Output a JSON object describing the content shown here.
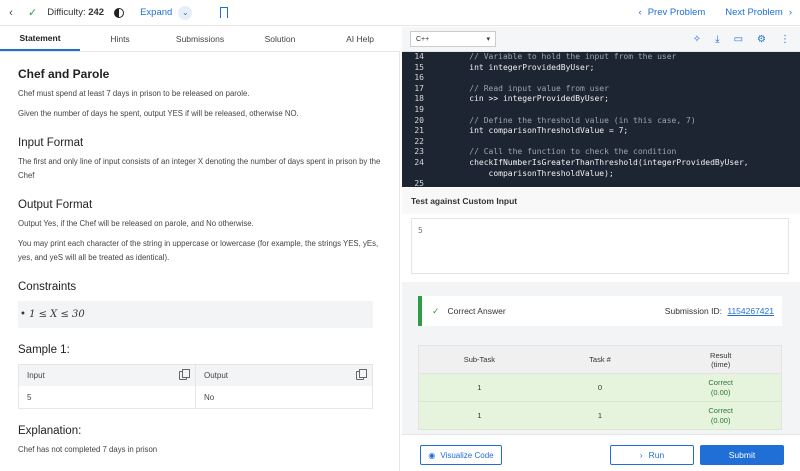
{
  "topbar": {
    "difficulty_label": "Difficulty:",
    "difficulty_value": "242",
    "expand_label": "Expand",
    "prev_label": "Prev Problem",
    "next_label": "Next Problem"
  },
  "tabs": [
    "Statement",
    "Hints",
    "Submissions",
    "Solution",
    "AI Help"
  ],
  "statement": {
    "title": "Chef and Parole",
    "p1": "Chef must spend at least 7 days in prison to be released on parole.",
    "p2": "Given the number of days he spent, output YES if will be released, otherwise NO.",
    "input_heading": "Input Format",
    "input_text": "The first and only line of input consists of an integer X denoting the number of days spent in prison by the Chef",
    "output_heading": "Output Format",
    "output_text1": "Output Yes, if the Chef will be released on parole, and No otherwise.",
    "output_text2": "You may print each character of the string in uppercase or lowercase (for example, the strings YES, yEs, yes, and yeS will all be treated as identical).",
    "constraints_heading": "Constraints",
    "constraint": "• 1 ≤ X ≤ 30",
    "sample_heading": "Sample 1:",
    "sample_input_label": "Input",
    "sample_output_label": "Output",
    "sample_input": "5",
    "sample_output": "No",
    "explanation_heading": "Explanation:",
    "explanation_text": "Chef has not completed 7 days in prison"
  },
  "editor": {
    "language": "C++",
    "lines": [
      {
        "n": "14",
        "code": "    // Variable to hold the input from the user",
        "comment": true
      },
      {
        "n": "15",
        "code": "    int integerProvidedByUser;",
        "comment": false
      },
      {
        "n": "16",
        "code": "",
        "comment": false
      },
      {
        "n": "17",
        "code": "    // Read input value from user",
        "comment": true
      },
      {
        "n": "18",
        "code": "    cin >> integerProvidedByUser;",
        "comment": false
      },
      {
        "n": "19",
        "code": "",
        "comment": false
      },
      {
        "n": "20",
        "code": "    // Define the threshold value (in this case, 7)",
        "comment": true
      },
      {
        "n": "21",
        "code": "    int comparisonThresholdValue = 7;",
        "comment": false
      },
      {
        "n": "22",
        "code": "",
        "comment": false
      },
      {
        "n": "23",
        "code": "    // Call the function to check the condition",
        "comment": true
      },
      {
        "n": "24",
        "code": "    checkIfNumberIsGreaterThanThreshold(integerProvidedByUser,",
        "comment": false
      },
      {
        "n": "",
        "code": "        comparisonThresholdValue);",
        "comment": false
      },
      {
        "n": "25",
        "code": "",
        "comment": false
      }
    ]
  },
  "custom": {
    "title": "Test against Custom Input",
    "input_value": "5"
  },
  "result": {
    "status": "Correct Answer",
    "submission_label": "Submission ID:",
    "submission_id": "1154267421",
    "headers": [
      "Sub-Task",
      "Task #",
      "Result\n(time)"
    ],
    "rows": [
      {
        "subtask": "1",
        "task": "0",
        "result": "Correct",
        "time": "(0.00)"
      },
      {
        "subtask": "1",
        "task": "1",
        "result": "Correct",
        "time": "(0.00)"
      }
    ]
  },
  "actions": {
    "visualize": "Visualize Code",
    "run": "Run",
    "submit": "Submit"
  },
  "colors": {
    "accent": "#1f6fd6",
    "success": "#2e9c46",
    "editor_bg": "#1e2532"
  }
}
